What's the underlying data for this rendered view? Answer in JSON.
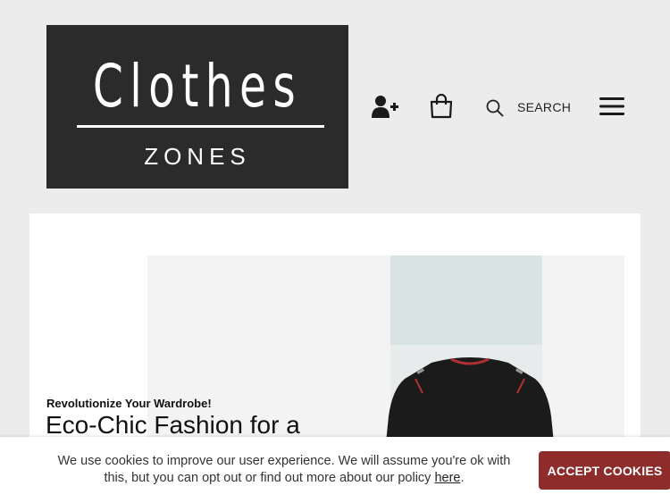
{
  "header": {
    "logo": {
      "top": "Clothes",
      "bottom": "ZONES"
    },
    "search_label": "SEARCH"
  },
  "hero": {
    "kicker": "Revolutionize Your Wardrobe!",
    "title": "Eco-Chic Fashion for a"
  },
  "cookies": {
    "message_before": "We use cookies to improve our user experience. We will assume you're ok with this, but you can opt out or find out more about our policy ",
    "policy_link": "here",
    "message_after": ".",
    "accept_label": "ACCEPT COOKIES"
  },
  "colors": {
    "logo_bg": "#2b2b2b",
    "accept_button": "#8e2b2b",
    "page_bg": "#ececec",
    "hero_teal": "#d9e3e4"
  },
  "icons": [
    "user-plus-icon",
    "shopping-bag-icon",
    "search-icon",
    "hamburger-menu-icon"
  ]
}
